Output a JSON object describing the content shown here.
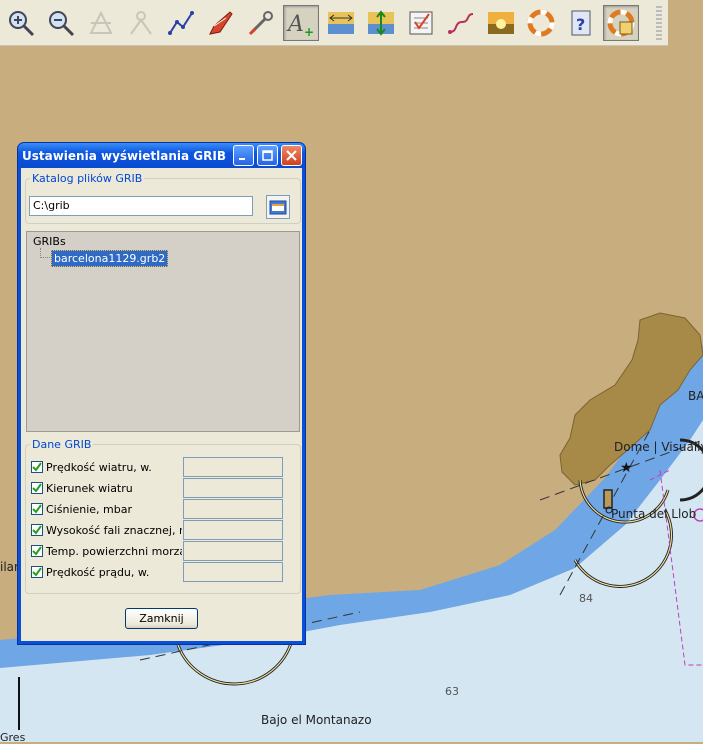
{
  "toolbar": {
    "buttons": [
      {
        "icon": "zoom-in-icon"
      },
      {
        "icon": "zoom-out-icon"
      },
      {
        "icon": "disabled-tool-icon"
      },
      {
        "icon": "disabled-tool-icon-2"
      },
      {
        "icon": "route-icon"
      },
      {
        "icon": "boat-icon"
      },
      {
        "icon": "wrench-icon"
      },
      {
        "icon": "text-add-icon",
        "pressed": true
      },
      {
        "icon": "depth-contour-icon"
      },
      {
        "icon": "tide-icon"
      },
      {
        "icon": "checklist-icon"
      },
      {
        "icon": "track-icon"
      },
      {
        "icon": "sunset-icon"
      },
      {
        "icon": "lifebuoy-icon"
      },
      {
        "icon": "help-icon"
      },
      {
        "icon": "lifebuoy-settings-icon",
        "pressed": true
      }
    ]
  },
  "dialog": {
    "title": "Ustawienia wyświetlania GRIB",
    "catalog_legend": "Katalog plików GRIB",
    "catalog_path": "C:\\grib",
    "tree_root": "GRIBs",
    "tree_file": "barcelona1129.grb2",
    "data_legend": "Dane GRIB",
    "items": [
      {
        "label": "Prędkość wiatru, w.",
        "checked": true
      },
      {
        "label": "Kierunek wiatru",
        "checked": true
      },
      {
        "label": "Ciśnienie, mbar",
        "checked": true
      },
      {
        "label": "Wysokość fali znacznej, m",
        "checked": true
      },
      {
        "label": "Temp. powierzchni morza, C",
        "checked": true
      },
      {
        "label": "Prędkość prądu, w.",
        "checked": true
      }
    ],
    "close_label": "Zamknij"
  },
  "map": {
    "labels": {
      "dome": "Dome | Visually",
      "punta": "Punta del Llob",
      "ba": "BA",
      "depth84": "84",
      "depth63": "63",
      "bajo": "Bajo el Montanazo",
      "ilan": "ilan",
      "gres": "Gres"
    },
    "colors": {
      "land": "#c8ad7f",
      "shallow": "#6fa6e6",
      "deep": "#d4e6f1",
      "urban": "#a88a48"
    }
  }
}
